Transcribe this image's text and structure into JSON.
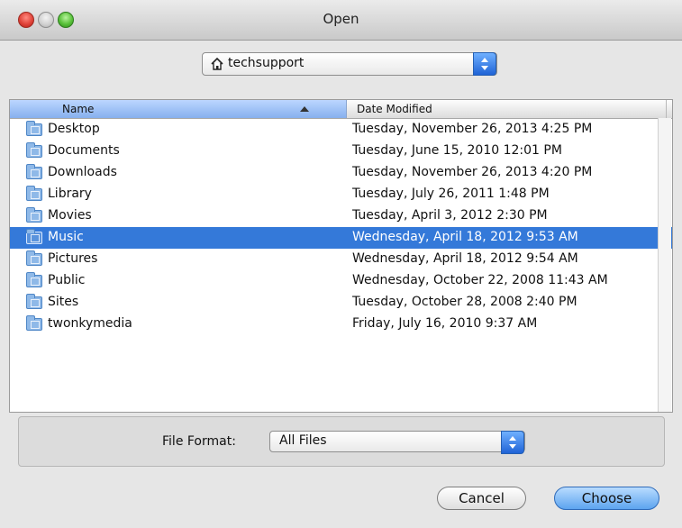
{
  "window": {
    "title": "Open"
  },
  "location": {
    "current": "techsupport",
    "icon": "home-icon"
  },
  "columns": {
    "name": "Name",
    "date": "Date Modified"
  },
  "files": [
    {
      "name": "Desktop",
      "date": "Tuesday, November 26, 2013 4:25 PM",
      "selected": false
    },
    {
      "name": "Documents",
      "date": "Tuesday, June 15, 2010 12:01 PM",
      "selected": false
    },
    {
      "name": "Downloads",
      "date": "Tuesday, November 26, 2013 4:20 PM",
      "selected": false
    },
    {
      "name": "Library",
      "date": "Tuesday, July 26, 2011 1:48 PM",
      "selected": false
    },
    {
      "name": "Movies",
      "date": "Tuesday, April 3, 2012 2:30 PM",
      "selected": false
    },
    {
      "name": "Music",
      "date": "Wednesday, April 18, 2012 9:53 AM",
      "selected": true
    },
    {
      "name": "Pictures",
      "date": "Wednesday, April 18, 2012 9:54 AM",
      "selected": false
    },
    {
      "name": "Public",
      "date": "Wednesday, October 22, 2008 11:43 AM",
      "selected": false
    },
    {
      "name": "Sites",
      "date": "Tuesday, October 28, 2008 2:40 PM",
      "selected": false
    },
    {
      "name": "twonkymedia",
      "date": "Friday, July 16, 2010 9:37 AM",
      "selected": false
    }
  ],
  "format": {
    "label": "File Format:",
    "value": "All Files"
  },
  "buttons": {
    "cancel": "Cancel",
    "choose": "Choose"
  },
  "colors": {
    "selection": "#3479d9",
    "accent": "#5da4ef"
  }
}
